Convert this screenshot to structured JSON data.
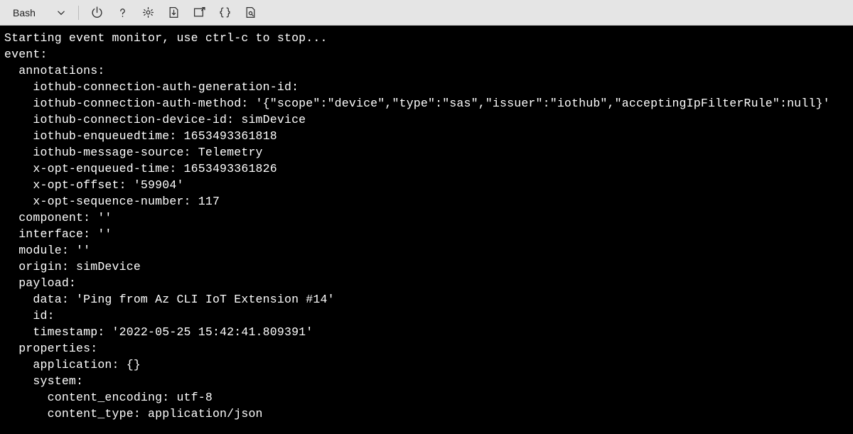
{
  "toolbar": {
    "shell_label": "Bash"
  },
  "terminal": {
    "lines": [
      "Starting event monitor, use ctrl-c to stop...",
      "event:",
      "  annotations:",
      "    iothub-connection-auth-generation-id:",
      "    iothub-connection-auth-method: '{\"scope\":\"device\",\"type\":\"sas\",\"issuer\":\"iothub\",\"acceptingIpFilterRule\":null}'",
      "    iothub-connection-device-id: simDevice",
      "    iothub-enqueuedtime: 1653493361818",
      "    iothub-message-source: Telemetry",
      "    x-opt-enqueued-time: 1653493361826",
      "    x-opt-offset: '59904'",
      "    x-opt-sequence-number: 117",
      "  component: ''",
      "  interface: ''",
      "  module: ''",
      "  origin: simDevice",
      "  payload:",
      "    data: 'Ping from Az CLI IoT Extension #14'",
      "    id:",
      "    timestamp: '2022-05-25 15:42:41.809391'",
      "  properties:",
      "    application: {}",
      "    system:",
      "      content_encoding: utf-8",
      "      content_type: application/json"
    ]
  }
}
